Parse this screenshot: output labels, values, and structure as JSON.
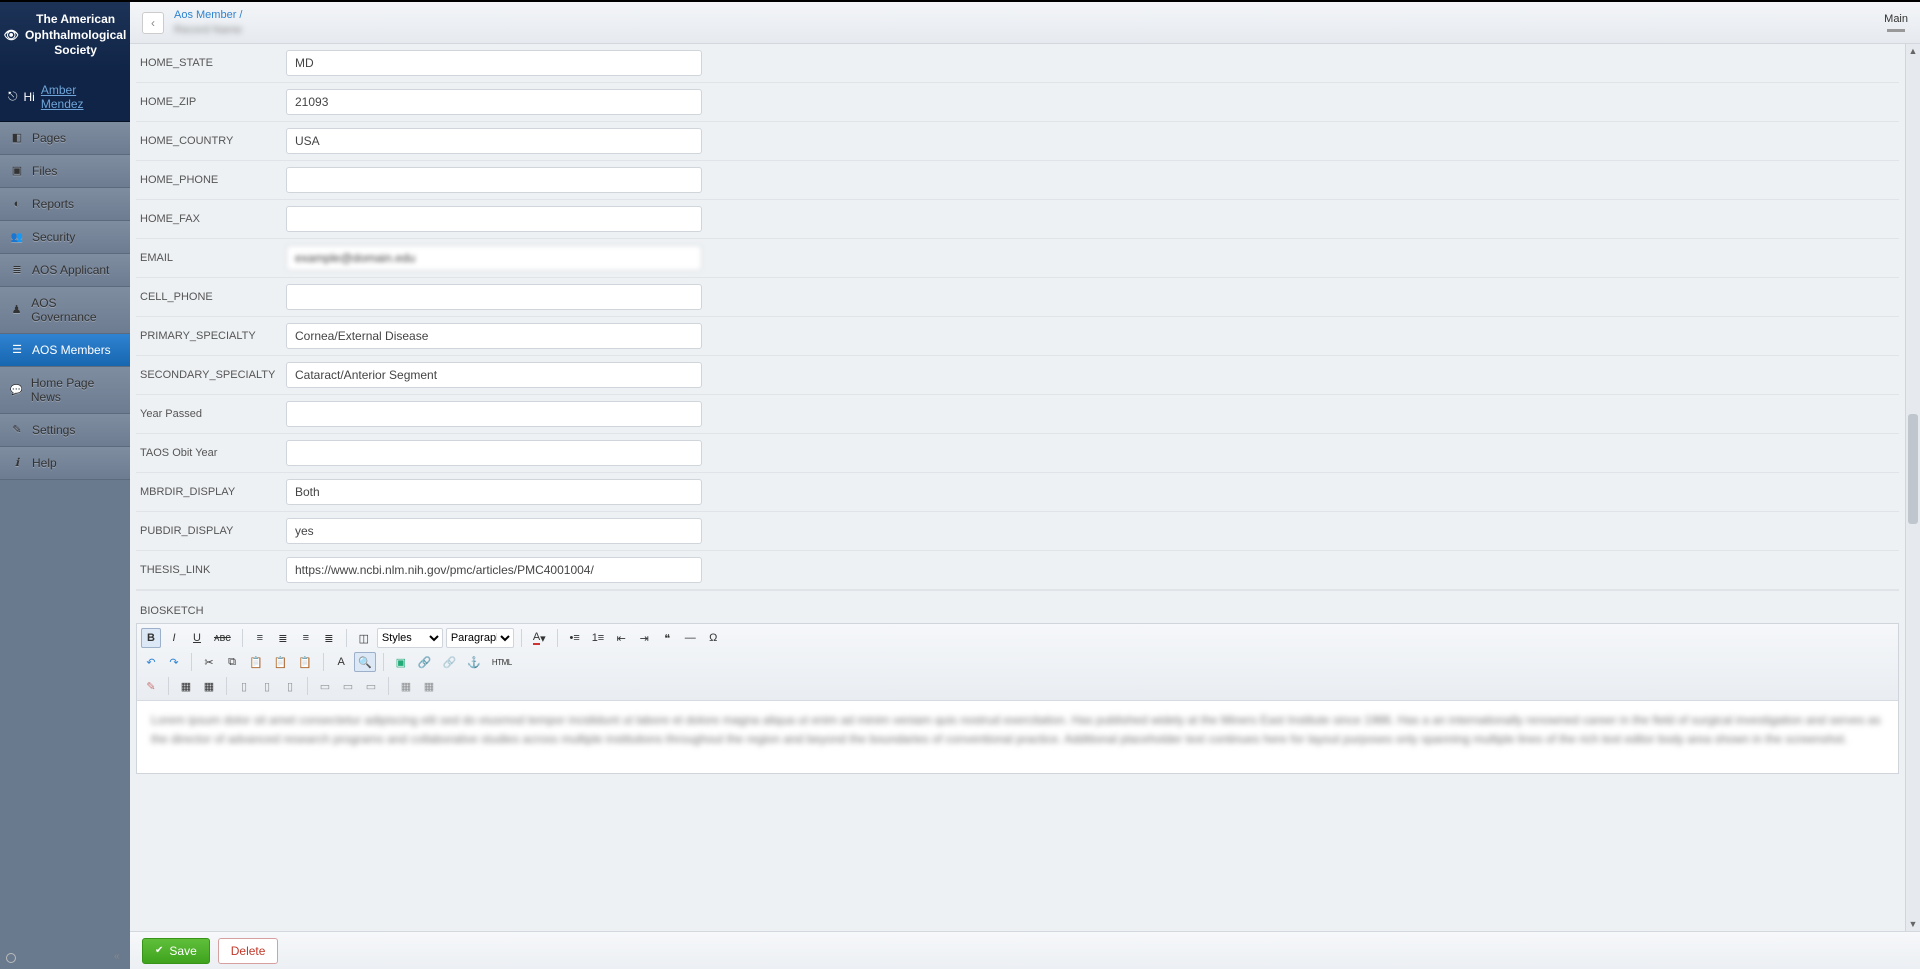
{
  "brand": {
    "title": "The American Ophthalmological Society"
  },
  "greeting": {
    "hi": "Hi",
    "name": "Amber Mendez"
  },
  "sidebar": {
    "items": [
      {
        "label": "Pages",
        "icon": "i-pages"
      },
      {
        "label": "Files",
        "icon": "i-files"
      },
      {
        "label": "Reports",
        "icon": "i-reports"
      },
      {
        "label": "Security",
        "icon": "i-security"
      },
      {
        "label": "AOS Applicant",
        "icon": "i-applicant"
      },
      {
        "label": "AOS Governance",
        "icon": "i-gov"
      },
      {
        "label": "AOS Members",
        "icon": "i-members",
        "active": true
      },
      {
        "label": "Home Page News",
        "icon": "i-news"
      },
      {
        "label": "Settings",
        "icon": "i-settings"
      },
      {
        "label": "Help",
        "icon": "i-help"
      }
    ]
  },
  "header": {
    "breadcrumb_parent": "Aos Member",
    "breadcrumb_current": "Record Name",
    "right_tab": "Main"
  },
  "fields": {
    "home_state": {
      "label": "HOME_STATE",
      "value": "MD"
    },
    "home_zip": {
      "label": "HOME_ZIP",
      "value": "21093"
    },
    "home_country": {
      "label": "HOME_COUNTRY",
      "value": "USA"
    },
    "home_phone": {
      "label": "HOME_PHONE",
      "value": ""
    },
    "home_fax": {
      "label": "HOME_FAX",
      "value": ""
    },
    "email": {
      "label": "EMAIL",
      "value": "example@domain.edu",
      "blurred": true
    },
    "cell_phone": {
      "label": "CELL_PHONE",
      "value": ""
    },
    "primary_specialty": {
      "label": "PRIMARY_SPECIALTY",
      "value": "Cornea/External Disease"
    },
    "secondary_specialty": {
      "label": "SECONDARY_SPECIALTY",
      "value": "Cataract/Anterior Segment"
    },
    "year_passed": {
      "label": "Year Passed",
      "value": ""
    },
    "taos_obit_year": {
      "label": "TAOS Obit Year",
      "value": ""
    },
    "mbrdir_display": {
      "label": "MBRDIR_DISPLAY",
      "value": "Both"
    },
    "pubdir_display": {
      "label": "PUBDIR_DISPLAY",
      "value": "yes"
    },
    "thesis_link": {
      "label": "THESIS_LINK",
      "value": "https://www.ncbi.nlm.nih.gov/pmc/articles/PMC4001004/",
      "partial_blur": true
    }
  },
  "biosketch": {
    "label": "BIOSKETCH",
    "toolbar": {
      "styles": "Styles",
      "paragraph": "Paragraph"
    },
    "body_placeholder": "Lorem ipsum dolor sit amet consectetur adipiscing elit sed do eiusmod tempor incididunt ut labore et dolore magna aliqua ut enim ad minim veniam quis nostrud exercitation. Has published widely at the Miners East Institute since 1986. Has a an internationally renowned career in the field of surgical investigation and serves as the director of advanced research programs and collaborative studies across multiple institutions throughout the region and beyond the boundaries of conventional practice. Additional placeholder text continues here for layout purposes only spanning multiple lines of the rich text editor body area shown in the screenshot."
  },
  "footer": {
    "save": "Save",
    "delete": "Delete"
  }
}
